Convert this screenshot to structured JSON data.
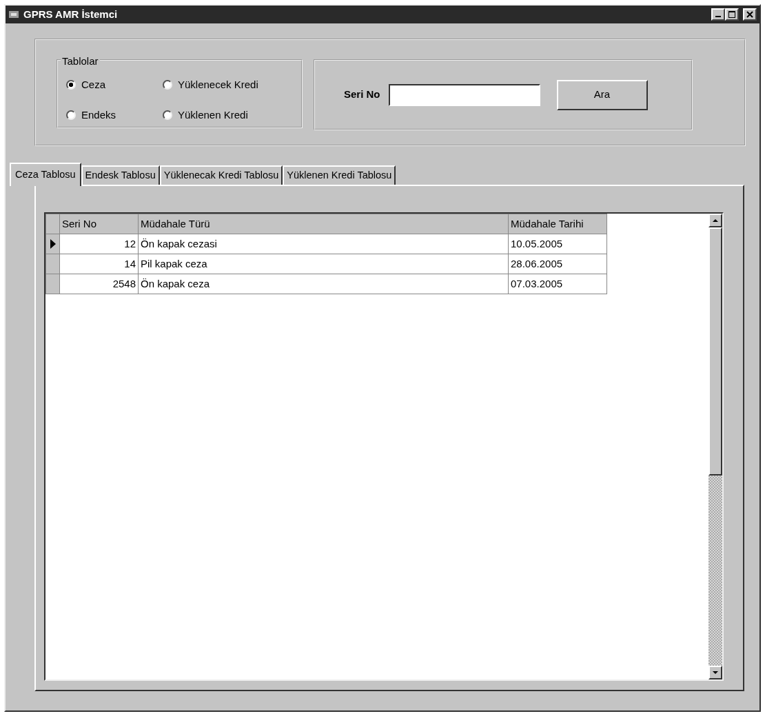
{
  "window": {
    "title": "GPRS AMR İstemci"
  },
  "tables_group": {
    "legend": "Tablolar",
    "options": [
      {
        "label": "Ceza",
        "selected": true
      },
      {
        "label": "Endeks",
        "selected": false
      },
      {
        "label": "Yüklenecek Kredi",
        "selected": false
      },
      {
        "label": "Yüklenen Kredi",
        "selected": false
      }
    ]
  },
  "search": {
    "label": "Seri No",
    "button": "Ara"
  },
  "tabs": [
    {
      "label": "Ceza Tablosu",
      "selected": true
    },
    {
      "label": "Endesk Tablosu",
      "selected": false
    },
    {
      "label": "Yüklenecak Kredi Tablosu",
      "selected": false
    },
    {
      "label": "Yüklenen Kredi Tablosu",
      "selected": false
    }
  ],
  "table": {
    "columns": [
      "Seri No",
      "Müdahale Türü",
      "Müdahale Tarihi"
    ],
    "rows": [
      {
        "cells": [
          "12",
          "Ön kapak cezasi",
          "10.05.2005"
        ],
        "selected": true
      },
      {
        "cells": [
          "14",
          "Pil kapak ceza",
          "28.06.2005"
        ],
        "selected": false
      },
      {
        "cells": [
          "2548",
          "Ön kapak ceza",
          "07.03.2005"
        ],
        "selected": false
      }
    ]
  }
}
